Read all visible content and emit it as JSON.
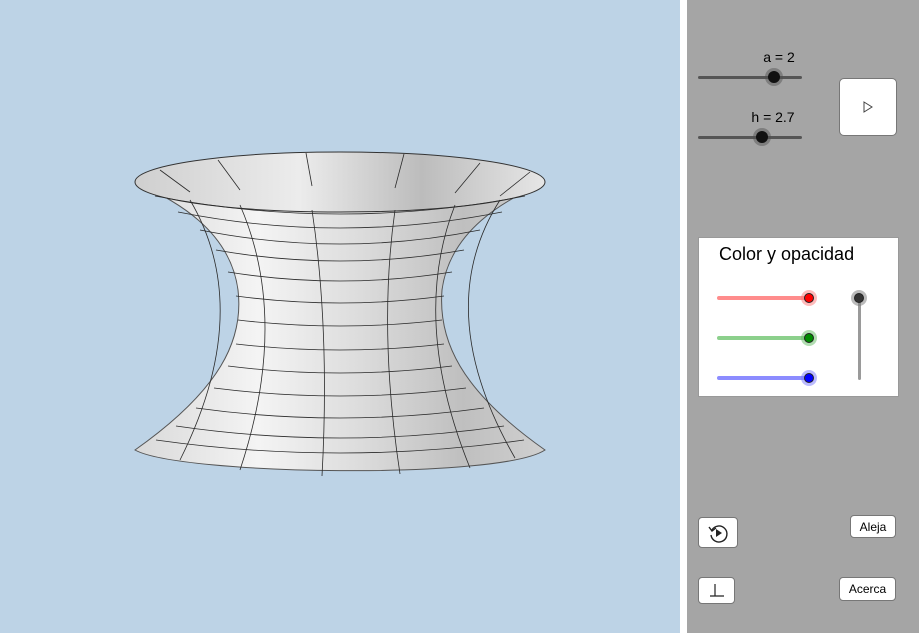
{
  "sliders": [
    {
      "label": "a = 2",
      "value": 2
    },
    {
      "label": "h = 2.7",
      "value": 2.7
    }
  ],
  "play_button": {
    "icon": "play-icon"
  },
  "color_panel": {
    "title": "Color y opacidad",
    "red": {
      "color": "#ff0000",
      "track": "#ff8c8c"
    },
    "green": {
      "color": "#008c00",
      "track": "#8cd08c"
    },
    "blue": {
      "color": "#0000ff",
      "track": "#8c8cff"
    },
    "opacity": {
      "color": "#333333",
      "track": "#9a9a9a"
    }
  },
  "buttons": {
    "reset_icon": "reset-icon",
    "zoom_out_label": "Aleja",
    "zoom_in_label": "Acerca",
    "axes_icon": "axes-icon"
  },
  "colors": {
    "view_background": "#bdd3e6",
    "panel_background": "#a5a5a5"
  }
}
